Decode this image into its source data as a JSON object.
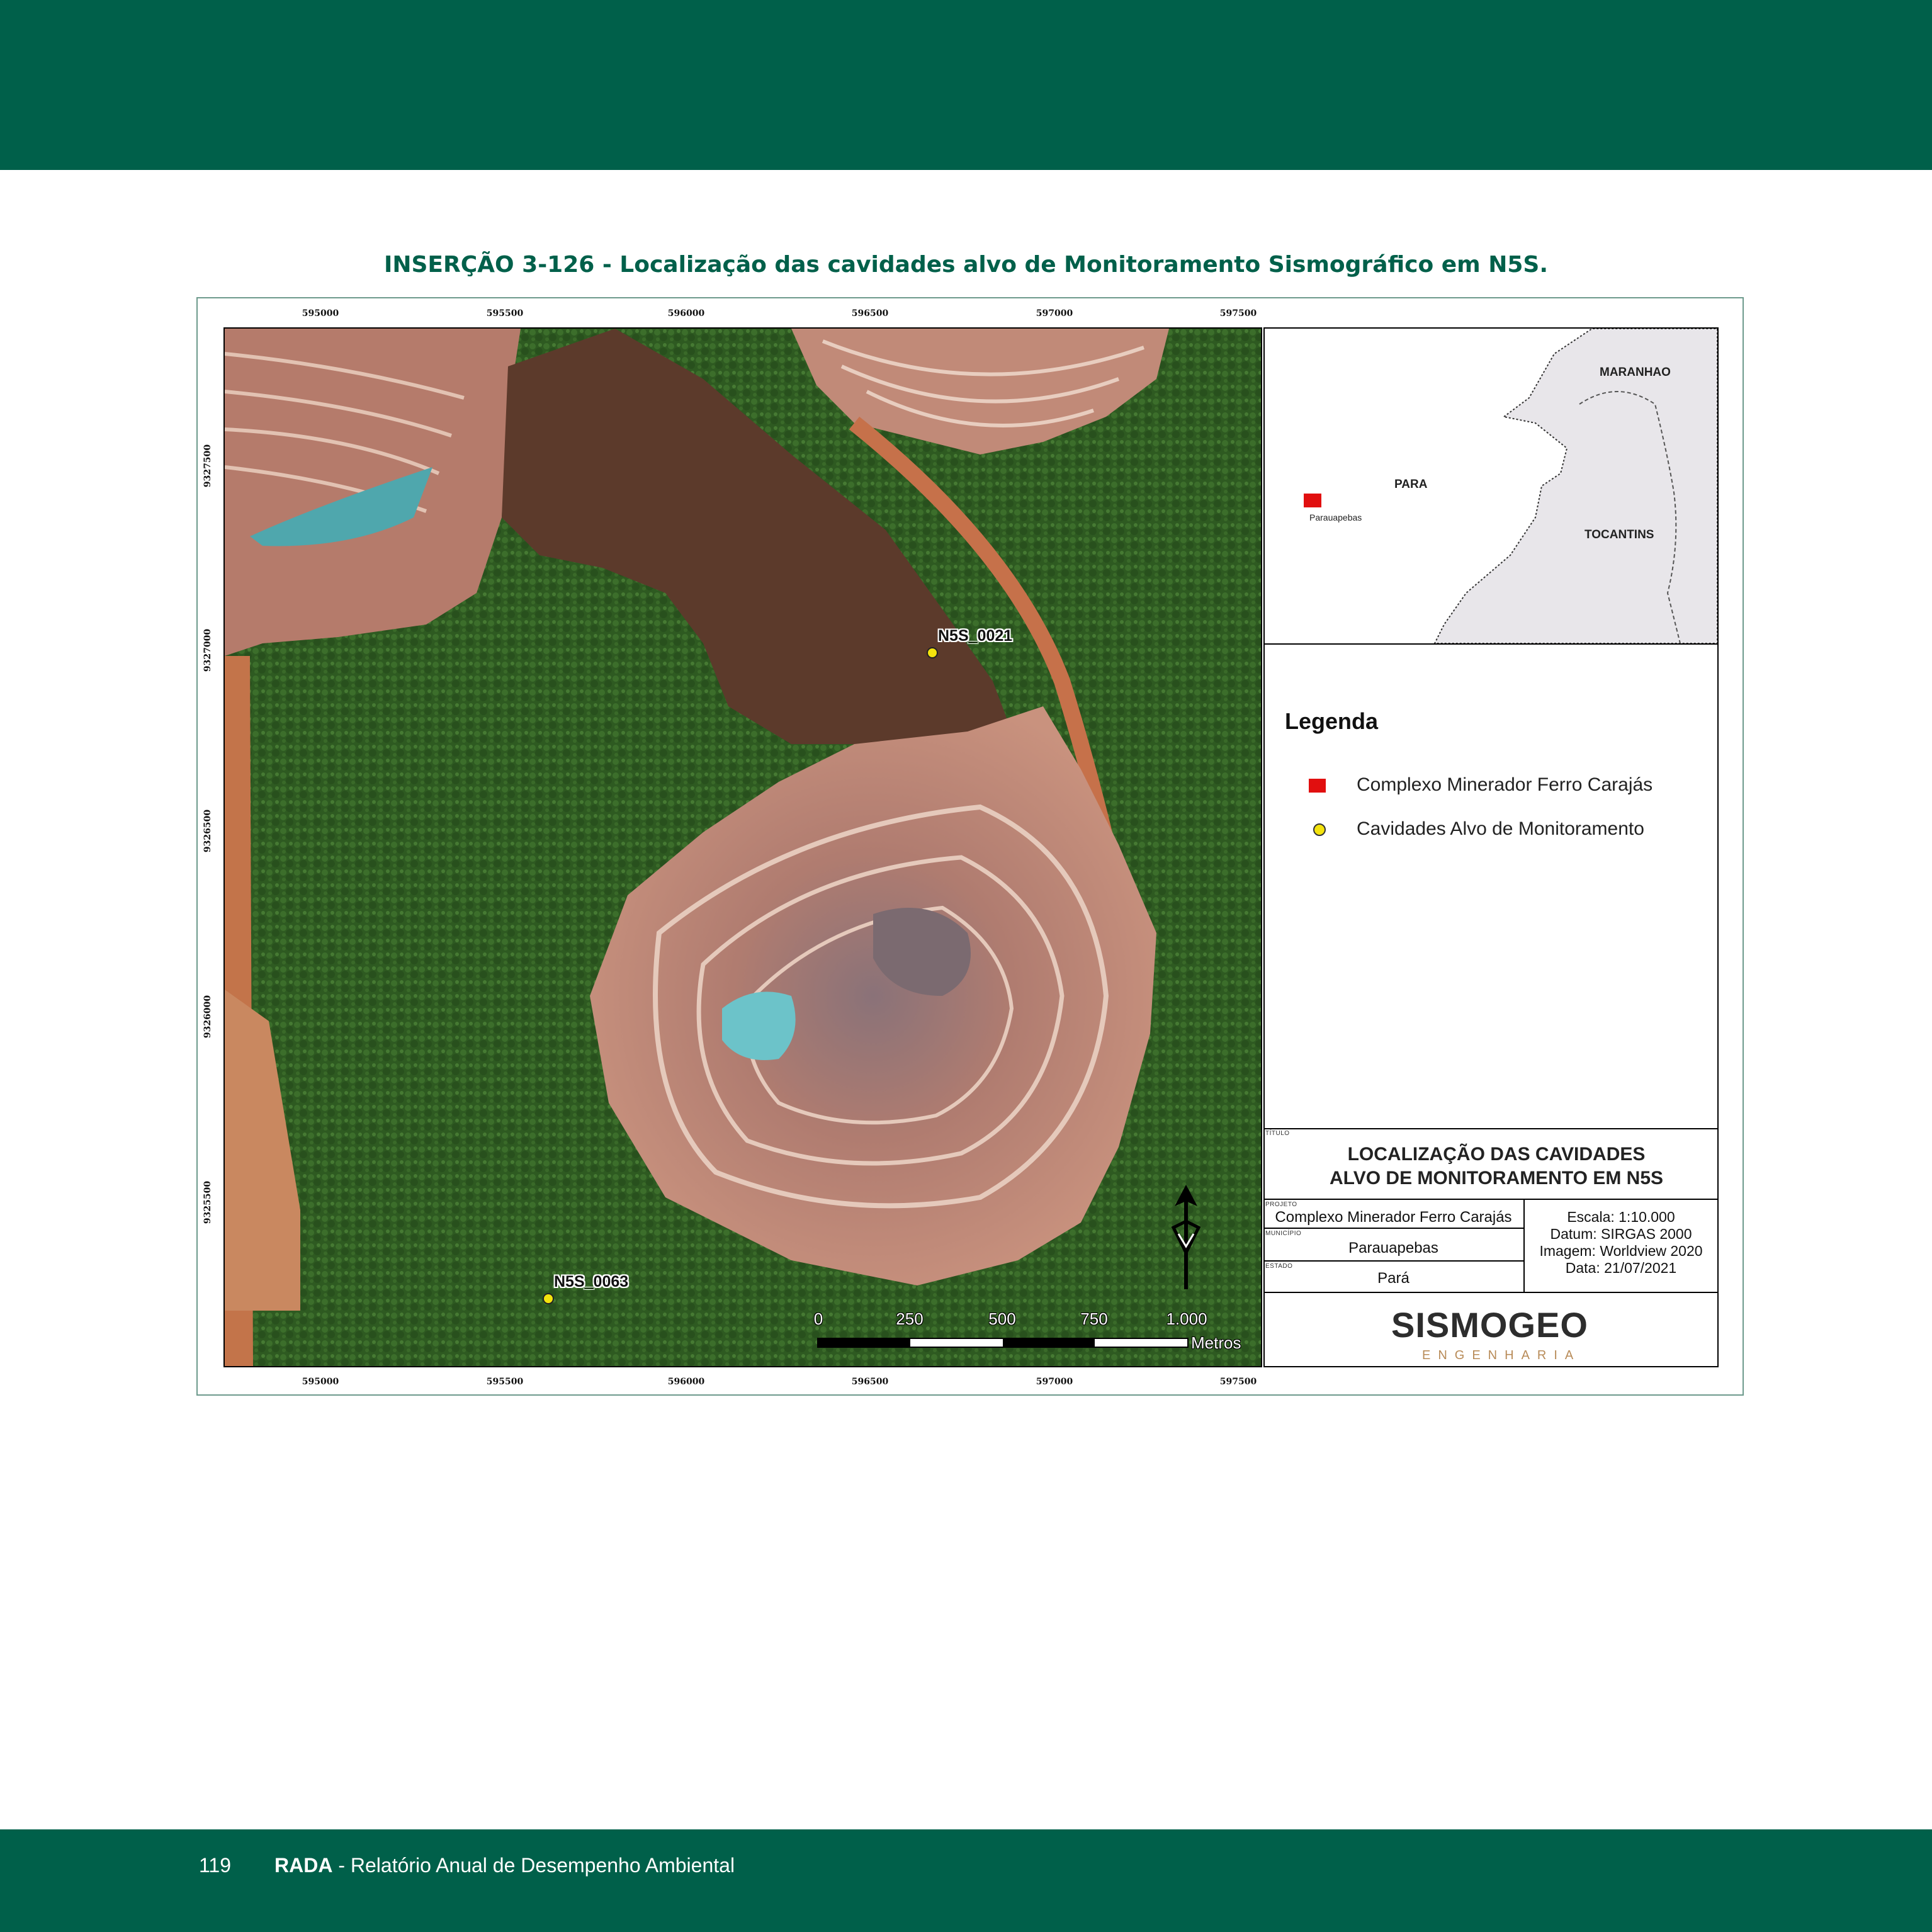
{
  "caption": "INSERÇÃO 3-126 - Localização das cavidades alvo de Monitoramento Sismográfico em N5S.",
  "map": {
    "x_ticks": [
      "595000",
      "595500",
      "596000",
      "596500",
      "597000",
      "597500"
    ],
    "y_ticks": [
      "9327500",
      "9327000",
      "9326500",
      "9326000",
      "9325500"
    ],
    "markers": [
      {
        "label": "N5S_0021"
      },
      {
        "label": "N5S_0063"
      }
    ],
    "scalebar": {
      "ticks": [
        "0",
        "250",
        "500",
        "750",
        "1.000"
      ],
      "unit": "Metros"
    },
    "colors": {
      "forest": "#2f5e22",
      "mine": "#b8786a",
      "road": "#c7703e",
      "water": "#6fc2c4",
      "marker": "#f4e30d"
    }
  },
  "inset": {
    "labels": {
      "maranhao": "MARANHAO",
      "para": "PARA",
      "tocantins": "TOCANTINS"
    },
    "city": "Parauapebas"
  },
  "legend": {
    "title": "Legenda",
    "items": [
      {
        "label": "Complexo Minerador Ferro Carajás",
        "symbol": "red-square",
        "color": "#e10f0f"
      },
      {
        "label": "Cavidades Alvo de Monitoramento",
        "symbol": "yellow-dot",
        "color": "#f4e30d"
      }
    ]
  },
  "title_block": {
    "titulo_caption": "TÍTULO",
    "title_line1": "LOCALIZAÇÃO DAS CAVIDADES",
    "title_line2": "ALVO DE MONITORAMENTO EM  N5S",
    "projeto_caption": "PROJETO",
    "projeto": "Complexo Minerador Ferro Carajás",
    "municipio_caption": "MUNICÍPIO",
    "municipio": "Parauapebas",
    "estado_caption": "ESTADO",
    "estado": "Pará",
    "escala": "Escala: 1:10.000",
    "datum": "Datum: SIRGAS 2000",
    "imagem": "Imagem: Worldview 2020",
    "data": "Data: 21/07/2021",
    "logo": "SISMOGEO",
    "logo_sub": "ENGENHARIA"
  },
  "footer": {
    "page": "119",
    "brand": "RADA",
    "text": " - Relatório Anual de Desempenho Ambiental"
  },
  "brand_color": "#00604a"
}
